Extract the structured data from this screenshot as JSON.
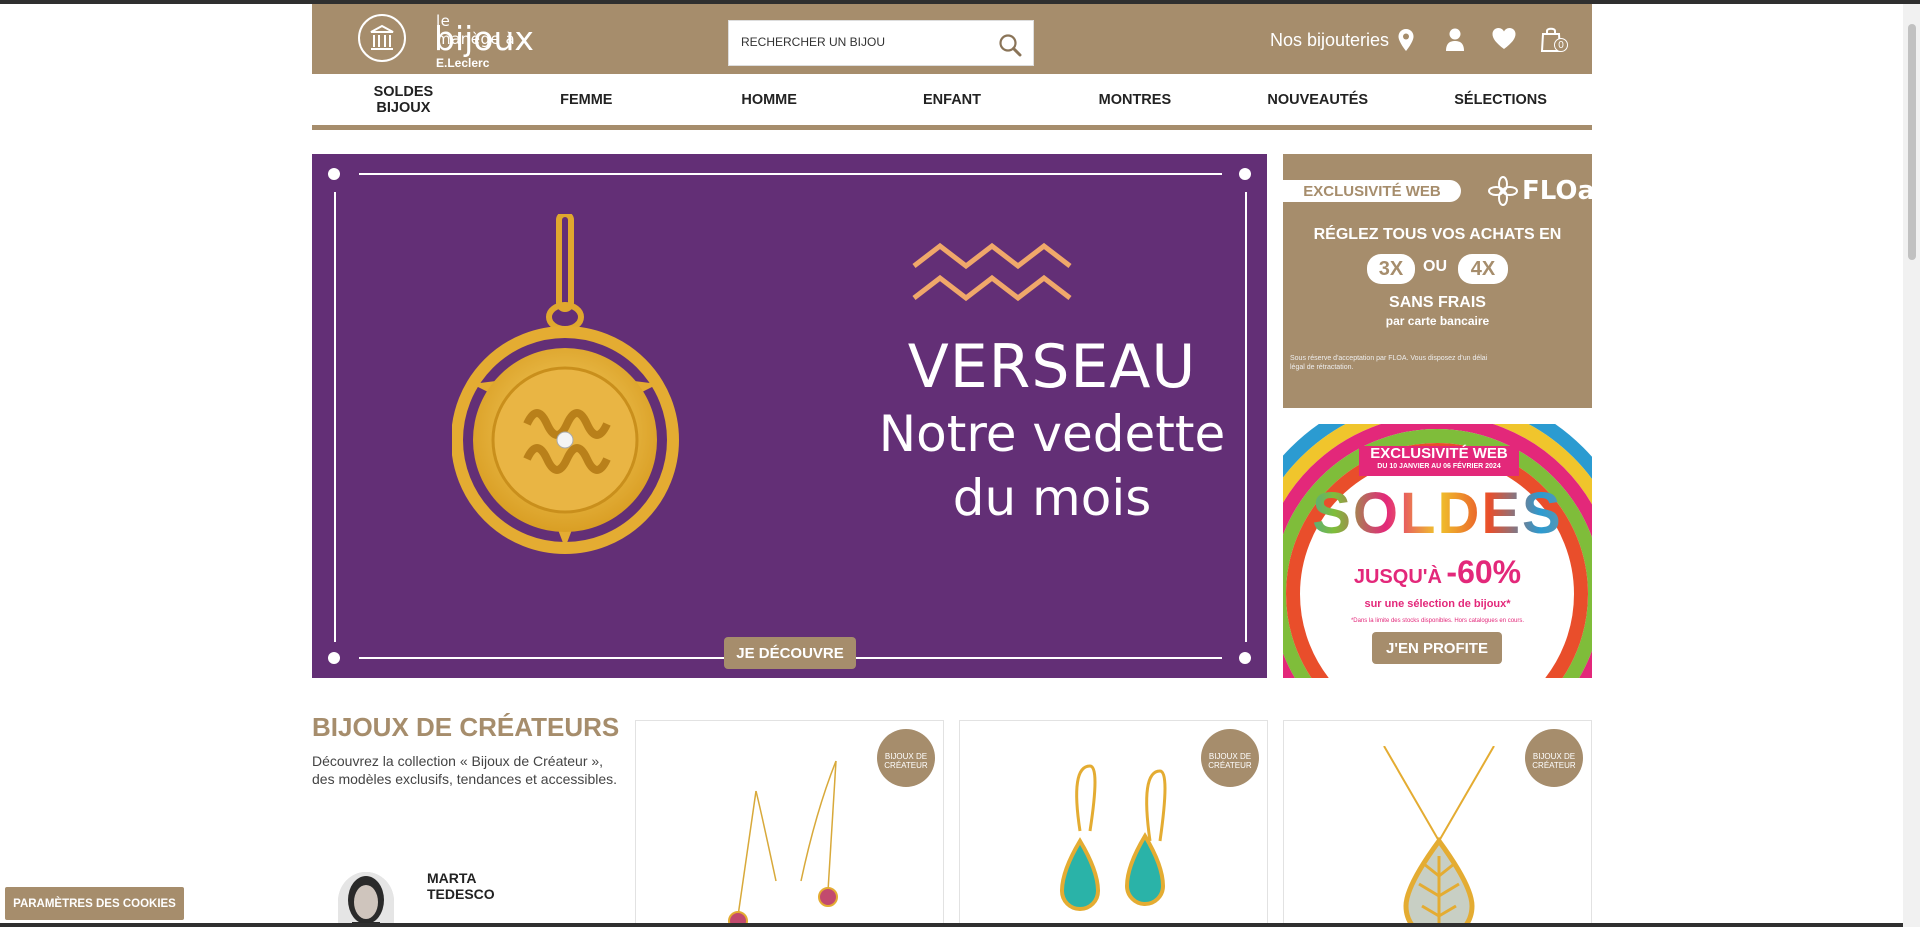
{
  "header": {
    "logo_line1": "le manège à",
    "logo_line2": "bijoux",
    "logo_line3": "E.Leclerc",
    "search_placeholder": "RECHERCHER UN BIJOU",
    "stores_label": "Nos bijouteries",
    "cart_count": "0"
  },
  "nav": {
    "items": [
      "SOLDES BIJOUX",
      "FEMME",
      "HOMME",
      "ENFANT",
      "MONTRES",
      "NOUVEAUTÉS",
      "SÉLECTIONS"
    ]
  },
  "hero": {
    "title": "VERSEAU",
    "subtitle_line1": "Notre vedette",
    "subtitle_line2": "du mois",
    "button": "JE DÉCOUVRE",
    "background": "#632f76"
  },
  "floa_banner": {
    "tag": "EXCLUSIVITÉ WEB",
    "brand": "FLOa",
    "line1": "RÉGLEZ TOUS VOS ACHATS EN",
    "opt1": "3X",
    "or": "OU",
    "opt2": "4X",
    "line2": "SANS FRAIS",
    "line3": "par carte bancaire",
    "fine_print": "Sous réserve d'acceptation par FLOA. Vous disposez d'un délai légal de rétractation."
  },
  "soldes_banner": {
    "tag": "EXCLUSIVITÉ WEB",
    "dates": "DU 10 JANVIER AU 06 FÉVRIER 2024",
    "title": "SOLDES",
    "discount_prefix": "JUSQU'À",
    "discount": "-60%",
    "subtitle": "sur une sélection de bijoux*",
    "fine_print": "*Dans la limite des stocks disponibles. Hors catalogues en cours.",
    "button": "J'EN PROFITE"
  },
  "creators": {
    "title": "BIJOUX DE CRÉATEURS",
    "description": "Découvrez la collection « Bijoux de Créateur », des modèles exclusifs, tendances et accessibles.",
    "designer_first": "MARTA",
    "designer_last": "TEDESCO",
    "badge_line1": "BIJOUX DE",
    "badge_line2": "CRÉATEUR"
  },
  "cookie_button": "PARAMÈTRES DES COOKIES",
  "colors": {
    "brand": "#a68d6c",
    "hero_purple": "#632f76",
    "gold": "#e8b24a",
    "pink": "#e3287a"
  }
}
